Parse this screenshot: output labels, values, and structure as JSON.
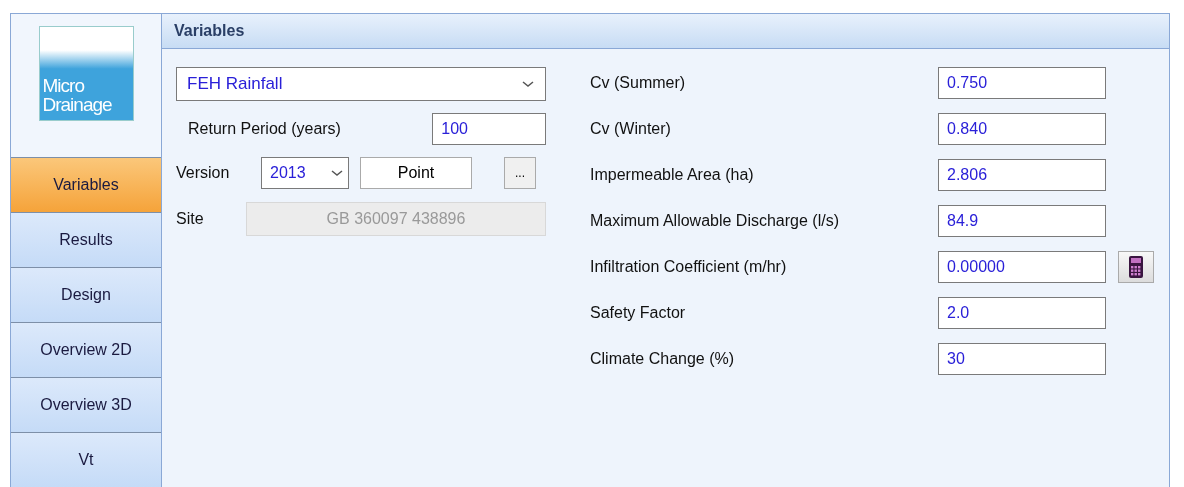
{
  "logo": {
    "lines": [
      "Micro",
      "Drainage"
    ]
  },
  "nav": [
    {
      "label": "Variables",
      "selected": true
    },
    {
      "label": "Results",
      "selected": false
    },
    {
      "label": "Design",
      "selected": false
    },
    {
      "label": "Overview 2D",
      "selected": false
    },
    {
      "label": "Overview 3D",
      "selected": false
    },
    {
      "label": "Vt",
      "selected": false
    }
  ],
  "panel": {
    "title": "Variables"
  },
  "rainfall": {
    "dropdown": "FEH Rainfall",
    "return_period_label": "Return Period (years)",
    "return_period": "100",
    "version_label": "Version",
    "version": "2013",
    "point_button": "Point",
    "browse_button": "...",
    "site_label": "Site",
    "site": "GB 360097 438896",
    "site_disabled": true
  },
  "variables": [
    {
      "label": "Cv (Summer)",
      "value": "0.750",
      "kind": "field"
    },
    {
      "label": "Cv (Winter)",
      "value": "0.840",
      "kind": "field"
    },
    {
      "label": "Impermeable Area (ha)",
      "value": "2.806",
      "kind": "field"
    },
    {
      "label": "Maximum Allowable Discharge (l/s)",
      "value": "84.9",
      "kind": "field"
    },
    {
      "label": "Infiltration Coefficient (m/hr)",
      "value": "0.00000",
      "kind": "calculator"
    },
    {
      "label": "Safety Factor",
      "value": "2.0",
      "kind": "field"
    },
    {
      "label": "Climate Change (%)",
      "value": "30",
      "kind": "field"
    }
  ]
}
